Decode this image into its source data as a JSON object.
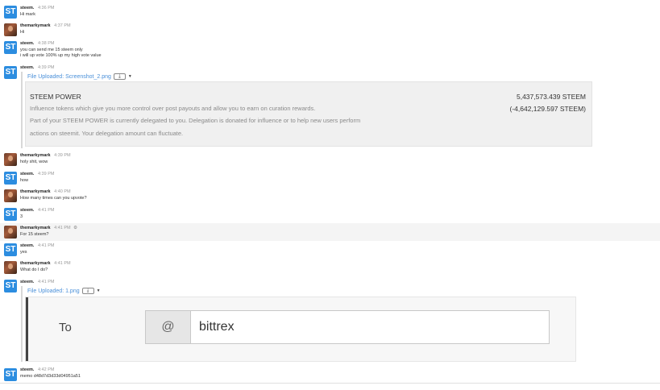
{
  "users": {
    "steem": "steem.",
    "mark": "themarkymark"
  },
  "avatar_initials": "ST",
  "messages": [
    {
      "user": "steem.",
      "time": "4:36 PM",
      "lines": [
        "Hi mark"
      ]
    },
    {
      "user": "themarkymark",
      "time": "4:37 PM",
      "lines": [
        "Hi"
      ]
    },
    {
      "user": "steem.",
      "time": "4:38 PM",
      "lines": [
        "you can send me 15 steem only",
        "i will up vote 100% up my high vote value"
      ]
    },
    {
      "user": "steem.",
      "time": "4:39 PM",
      "upload": "File Uploaded: Screenshot_2.png"
    },
    {
      "user": "themarkymark",
      "time": "4:39 PM",
      "lines": [
        "holy shit, wow"
      ]
    },
    {
      "user": "steem.",
      "time": "4:39 PM",
      "lines": [
        "how"
      ]
    },
    {
      "user": "themarkymark",
      "time": "4:40 PM",
      "lines": [
        "How many times can you upvote?"
      ]
    },
    {
      "user": "steem.",
      "time": "4:41 PM",
      "lines": [
        "3"
      ]
    },
    {
      "user": "themarkymark",
      "time": "4:41 PM",
      "lines": [
        "For 15 steem?"
      ]
    },
    {
      "user": "steem.",
      "time": "4:41 PM",
      "lines": [
        "yes"
      ]
    },
    {
      "user": "themarkymark",
      "time": "4:41 PM",
      "lines": [
        "What do I do?"
      ]
    },
    {
      "user": "steem.",
      "time": "4:41 PM",
      "upload": "File Uploaded: 1.png"
    },
    {
      "user": "steem.",
      "time": "4:42 PM",
      "lines": [
        "memo d48d7d3d33d04951a51"
      ]
    }
  ],
  "steem_power_card": {
    "title": "STEEM POWER",
    "desc1": "Influence tokens which give you more control over post payouts and allow you to earn on curation rewards.",
    "desc2": "Part of your STEEM POWER is currently delegated to you. Delegation is donated for influence or to help new users perform",
    "desc3": "actions on steemit. Your delegation amount can fluctuate.",
    "value": "5,437,573.439 STEEM",
    "delegated": "(-4,642,129.597 STEEM)"
  },
  "transfer_card": {
    "to_label": "To",
    "at_symbol": "@",
    "recipient": "bittrex"
  },
  "icons": {
    "download": "download-icon",
    "caret": "caret-down-icon",
    "gear": "gear-icon"
  },
  "colors": {
    "accent": "#2c8de0",
    "link": "#4a90d9"
  }
}
